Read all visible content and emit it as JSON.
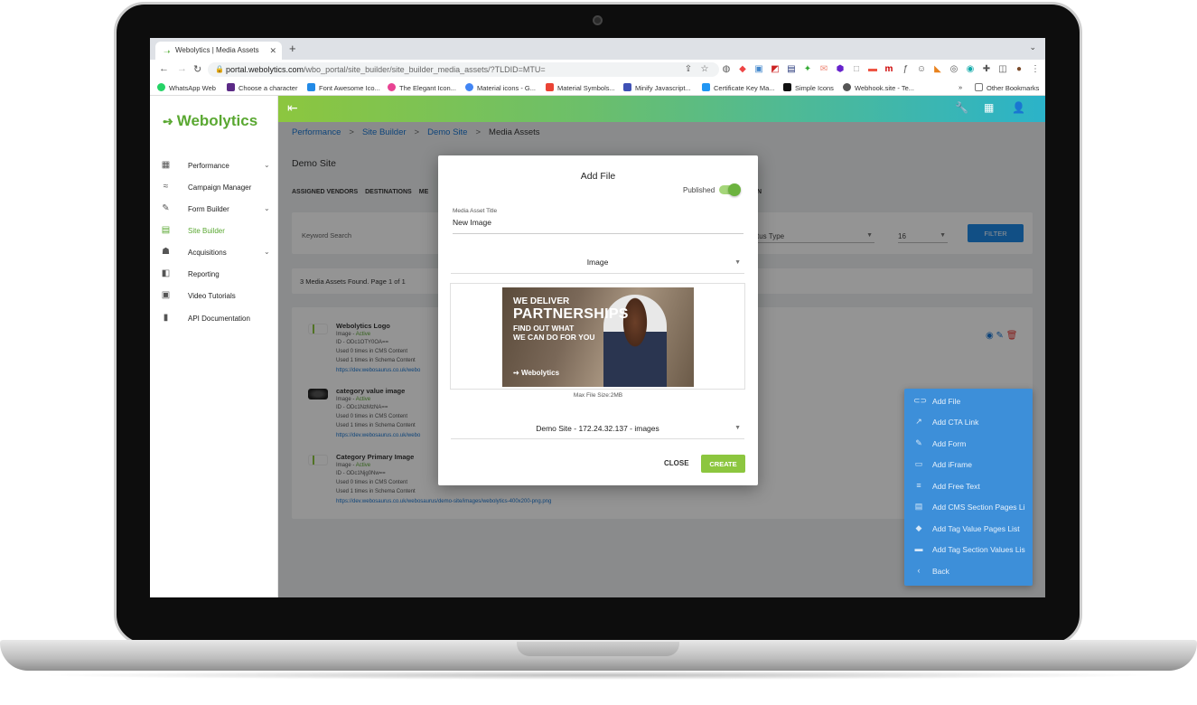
{
  "browser": {
    "tab_title": "Webolytics | Media Assets",
    "url_host": "portal.webolytics.com",
    "url_path": "/wbo_portal/site_builder/site_builder_media_assets/?TLDID=MTU=",
    "bookmarks": [
      {
        "label": "WhatsApp Web",
        "color": "#25d366"
      },
      {
        "label": "Choose a character",
        "color": "#5b2a86"
      },
      {
        "label": "Font Awesome Ico...",
        "color": "#228ae6"
      },
      {
        "label": "The Elegant Icon...",
        "color": "#e84393"
      },
      {
        "label": "Material icons - G...",
        "color": "#4285f4"
      },
      {
        "label": "Material Symbols...",
        "color": "#ea4335"
      },
      {
        "label": "Minify Javascript...",
        "color": "#3f51b5"
      },
      {
        "label": "Certificate Key Ma...",
        "color": "#2196f3"
      },
      {
        "label": "Simple Icons",
        "color": "#111111"
      },
      {
        "label": "Webhook.site - Te...",
        "color": "#555555"
      }
    ],
    "more_bookmarks": "»",
    "other_bookmarks": "Other Bookmarks"
  },
  "app": {
    "logo_text": "Webolytics",
    "sidebar": [
      {
        "label": "Performance",
        "icon": "dashboard-icon",
        "glyph": "▦",
        "chevron": true,
        "active": false
      },
      {
        "label": "Campaign Manager",
        "icon": "trend-icon",
        "glyph": "≈",
        "chevron": false,
        "active": false
      },
      {
        "label": "Form Builder",
        "icon": "form-icon",
        "glyph": "✎",
        "chevron": true,
        "active": false
      },
      {
        "label": "Site Builder",
        "icon": "web-icon",
        "glyph": "▤",
        "chevron": false,
        "active": true
      },
      {
        "label": "Acquisitions",
        "icon": "people-icon",
        "glyph": "☗",
        "chevron": true,
        "active": false
      },
      {
        "label": "Reporting",
        "icon": "report-icon",
        "glyph": "◧",
        "chevron": false,
        "active": false
      },
      {
        "label": "Video Tutorials",
        "icon": "video-icon",
        "glyph": "▣",
        "chevron": false,
        "active": false
      },
      {
        "label": "API Documentation",
        "icon": "book-icon",
        "glyph": "▮",
        "chevron": false,
        "active": false
      }
    ],
    "breadcrumbs": [
      "Performance",
      "Site Builder",
      "Demo Site",
      "Media Assets"
    ],
    "page_title": "Demo Site",
    "tabs": [
      "ASSIGNED VENDORS",
      "DESTINATIONS",
      "ME"
    ],
    "tabs_tail": "N",
    "filters": {
      "keyword_placeholder": "Keyword Search",
      "status_label": "tus Type",
      "per_page": "16",
      "filter_button": "FILTER"
    },
    "count_text": "3 Media Assets Found. Page 1 of 1",
    "assets": [
      {
        "title": "Webolytics Logo",
        "type_prefix": "Image - ",
        "status": "Active",
        "id": "ID - ODc1OTY0OA==",
        "cms": "Used 0 times in CMS Content",
        "schema": "Used 1 times in Schema Content",
        "url": "https://dev.webosaurus.co.uk/webo"
      },
      {
        "title": "category value image",
        "type_prefix": "Image - ",
        "status": "Active",
        "id": "ID - ODc1NzMzNA==",
        "cms": "Used 0 times in CMS Content",
        "schema": "Used 1 times in Schema Content",
        "url": "https://dev.webosaurus.co.uk/webo"
      },
      {
        "title": "Category Primary Image",
        "type_prefix": "Image - ",
        "status": "Active",
        "id": "ID - ODc1Njg0Nw==",
        "cms": "Used 0 times in CMS Content",
        "schema": "Used 1 times in Schema Content",
        "url": "https://dev.webosaurus.co.uk/webosaurus/demo-site/images/webolytics-400x200-png.png"
      }
    ],
    "floating_menu": [
      {
        "label": "Add File",
        "icon": "link-icon",
        "glyph": "⊂⊃"
      },
      {
        "label": "Add CTA Link",
        "icon": "external-link-icon",
        "glyph": "↗"
      },
      {
        "label": "Add Form",
        "icon": "form-icon",
        "glyph": "✎"
      },
      {
        "label": "Add iFrame",
        "icon": "iframe-icon",
        "glyph": "▭"
      },
      {
        "label": "Add Free Text",
        "icon": "text-icon",
        "glyph": "≡"
      },
      {
        "label": "Add CMS Section Pages Li",
        "icon": "article-icon",
        "glyph": "▤"
      },
      {
        "label": "Add Tag Value Pages List",
        "icon": "tag-icon",
        "glyph": "◆"
      },
      {
        "label": "Add Tag Section Values Lis",
        "icon": "label-icon",
        "glyph": "▬"
      },
      {
        "label": "Back",
        "icon": "chevron-left-icon",
        "glyph": "‹"
      }
    ]
  },
  "modal": {
    "title": "Add File",
    "published_label": "Published",
    "title_field_label": "Media Asset Title",
    "title_field_value": "New Image",
    "type_select": "Image",
    "banner": {
      "line1": "WE DELIVER",
      "line2": "PARTNERSHIPS",
      "line3": "FIND OUT WHAT",
      "line4": "WE CAN DO FOR YOU",
      "brand": "Webolytics"
    },
    "max_size": "Max File Size:2MB",
    "location_select": "Demo Site - 172.24.32.137 - images",
    "close_label": "CLOSE",
    "create_label": "CREATE"
  }
}
